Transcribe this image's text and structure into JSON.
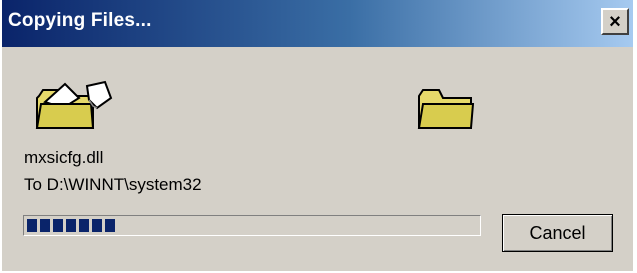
{
  "window": {
    "title": "Copying Files...",
    "close_symbol": "×"
  },
  "icons": {
    "source": "folder-with-flying-paper-icon",
    "destination": "open-folder-icon"
  },
  "file": {
    "name": "mxsicfg.dll",
    "destination_text": "To D:\\WINNT\\system32"
  },
  "progress": {
    "fraction": 0.22,
    "color": "#0a246a"
  },
  "buttons": {
    "cancel_label": "Cancel"
  }
}
